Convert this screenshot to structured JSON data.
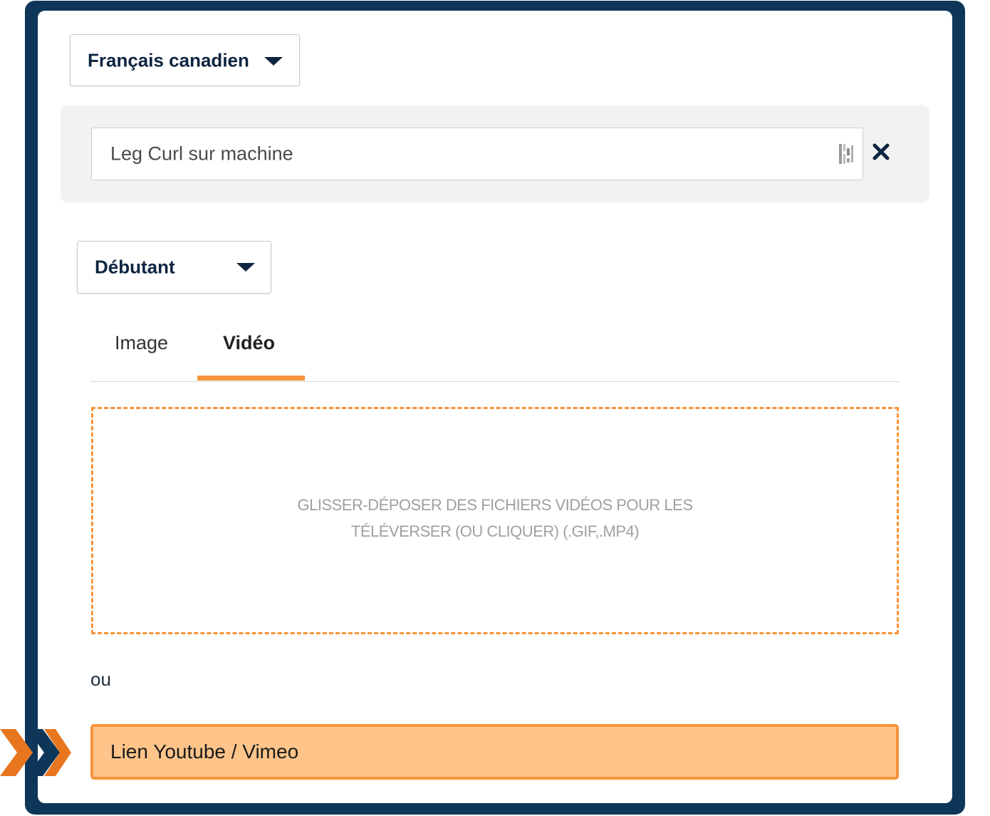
{
  "language_select": {
    "value": "Français canadien",
    "icon": "chevron-down-icon"
  },
  "exercise_name": {
    "value": "Leg Curl sur machine",
    "clear_icon": "close-icon"
  },
  "level_select": {
    "value": "Débutant",
    "icon": "chevron-down-icon"
  },
  "media_tabs": [
    {
      "label": "Image",
      "active": false
    },
    {
      "label": "Vidéo",
      "active": true
    }
  ],
  "dropzone": {
    "line1": "GLISSER-DÉPOSER DES FICHIERS VIDÉOS POUR LES",
    "line2": "TÉLÉVERSER (OU CLIQUER) (.GIF,.MP4)"
  },
  "separator_text": "ou",
  "video_link": {
    "placeholder": "Lien Youtube / Vimeo"
  },
  "colors": {
    "frame": "#0d3658",
    "accent": "#f5943a",
    "link_fill": "#fec48a",
    "text_dark": "#0d2540"
  }
}
